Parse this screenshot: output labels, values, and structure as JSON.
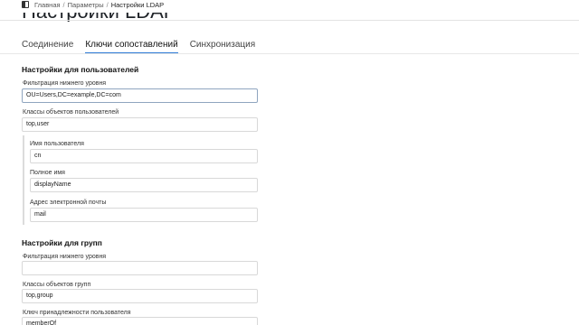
{
  "breadcrumbs": [
    "Главная",
    "Параметры",
    "Настройки LDAP"
  ],
  "page_title": "Настройки LDAP",
  "tabs": [
    "Соединение",
    "Ключи сопоставлений",
    "Синхронизация"
  ],
  "users": {
    "section_title": "Настройки для пользователей",
    "filter_label": "Фильтрация нижнего уровня",
    "filter_value": "OU=Users,DC=example,DC=com",
    "classes_label": "Классы объектов пользователей",
    "classes_value": "top,user",
    "username_label": "Имя пользователя",
    "username_value": "cn",
    "fullname_label": "Полное имя",
    "fullname_value": "displayName",
    "email_label": "Адрес электронной почты",
    "email_value": "mail"
  },
  "groups": {
    "section_title": "Настройки для групп",
    "filter_label": "Фильтрация нижнего уровня",
    "filter_value": "",
    "classes_label": "Классы объектов групп",
    "classes_value": "top,group",
    "membership_label": "Ключ принадлежности пользователя",
    "membership_value": "memberOf"
  }
}
